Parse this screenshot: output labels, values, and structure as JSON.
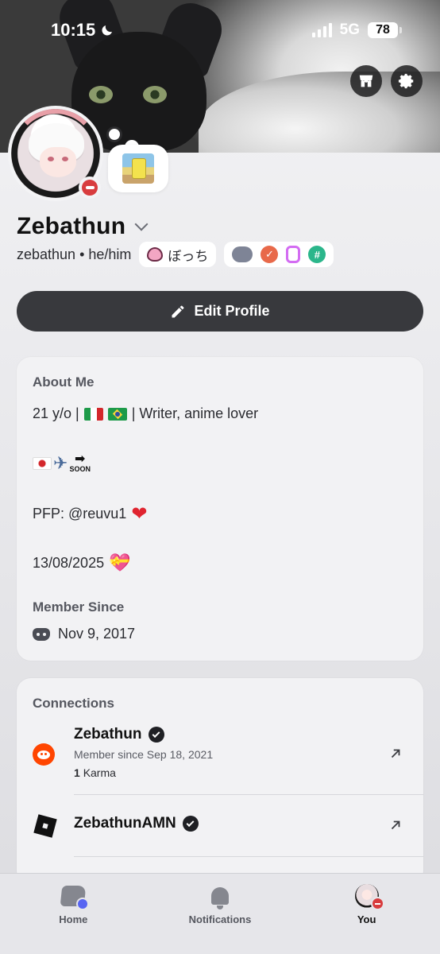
{
  "status_bar": {
    "time": "10:15",
    "network": "5G",
    "battery": "78"
  },
  "profile": {
    "display_name": "Zebathun",
    "username": "zebathun",
    "pronouns": "he/him",
    "tag_text": "ぼっち",
    "edit_button": "Edit Profile"
  },
  "about": {
    "heading": "About Me",
    "line1_prefix": "21 y/o |",
    "line1_suffix": "| Writer, anime lover",
    "soon_label": "SOON",
    "pfp_line": "PFP: @reuvu1",
    "date_line": "13/08/2025",
    "member_heading": "Member Since",
    "member_date": "Nov 9, 2017"
  },
  "connections": {
    "heading": "Connections",
    "items": [
      {
        "name": "Zebathun",
        "subtitle": "Member since Sep 18, 2021",
        "karma_value": "1",
        "karma_label": "Karma"
      },
      {
        "name": "ZebathunAMN"
      }
    ]
  },
  "nav": {
    "home": "Home",
    "notifications": "Notifications",
    "you": "You"
  },
  "colors": {
    "accent": "#5865f2",
    "dnd": "#d83c3e",
    "button_dark": "#38393d"
  }
}
